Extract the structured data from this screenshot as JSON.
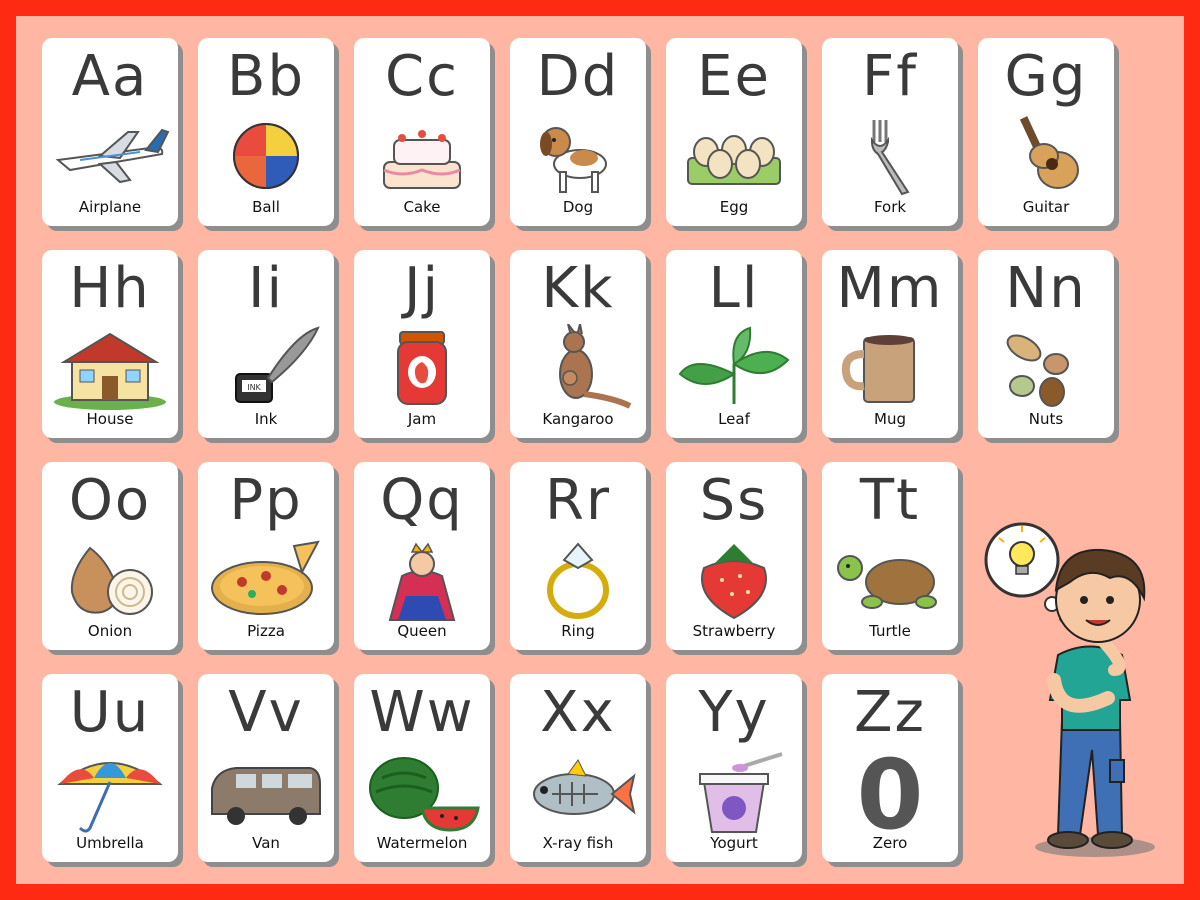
{
  "cards": [
    {
      "upper": "A",
      "lower": "a",
      "word": "Airplane",
      "icon": "airplane-icon"
    },
    {
      "upper": "B",
      "lower": "b",
      "word": "Ball",
      "icon": "ball-icon"
    },
    {
      "upper": "C",
      "lower": "c",
      "word": "Cake",
      "icon": "cake-icon"
    },
    {
      "upper": "D",
      "lower": "d",
      "word": "Dog",
      "icon": "dog-icon"
    },
    {
      "upper": "E",
      "lower": "e",
      "word": "Egg",
      "icon": "egg-icon"
    },
    {
      "upper": "F",
      "lower": "f",
      "word": "Fork",
      "icon": "fork-icon"
    },
    {
      "upper": "G",
      "lower": "g",
      "word": "Guitar",
      "icon": "guitar-icon"
    },
    {
      "upper": "H",
      "lower": "h",
      "word": "House",
      "icon": "house-icon"
    },
    {
      "upper": "I",
      "lower": "i",
      "word": "Ink",
      "icon": "ink-icon",
      "extra": "INK"
    },
    {
      "upper": "J",
      "lower": "j",
      "word": "Jam",
      "icon": "jam-icon"
    },
    {
      "upper": "K",
      "lower": "k",
      "word": "Kangaroo",
      "icon": "kangaroo-icon"
    },
    {
      "upper": "L",
      "lower": "l",
      "word": "Leaf",
      "icon": "leaf-icon"
    },
    {
      "upper": "M",
      "lower": "m",
      "word": "Mug",
      "icon": "mug-icon"
    },
    {
      "upper": "N",
      "lower": "n",
      "word": "Nuts",
      "icon": "nuts-icon"
    },
    {
      "upper": "O",
      "lower": "o",
      "word": "Onion",
      "icon": "onion-icon"
    },
    {
      "upper": "P",
      "lower": "p",
      "word": "Pizza",
      "icon": "pizza-icon"
    },
    {
      "upper": "Q",
      "lower": "q",
      "word": "Queen",
      "icon": "queen-icon"
    },
    {
      "upper": "R",
      "lower": "r",
      "word": "Ring",
      "icon": "ring-icon"
    },
    {
      "upper": "S",
      "lower": "s",
      "word": "Strawberry",
      "icon": "strawberry-icon"
    },
    {
      "upper": "T",
      "lower": "t",
      "word": "Turtle",
      "icon": "turtle-icon"
    },
    {
      "upper": "U",
      "lower": "u",
      "word": "Umbrella",
      "icon": "umbrella-icon"
    },
    {
      "upper": "V",
      "lower": "v",
      "word": "Van",
      "icon": "van-icon"
    },
    {
      "upper": "W",
      "lower": "w",
      "word": "Watermelon",
      "icon": "watermelon-icon"
    },
    {
      "upper": "X",
      "lower": "x",
      "word": "X-ray  fish",
      "icon": "xray-fish-icon"
    },
    {
      "upper": "Y",
      "lower": "y",
      "word": "Yogurt",
      "icon": "yogurt-icon"
    },
    {
      "upper": "Z",
      "lower": "z",
      "word": "Zero",
      "icon": "zero-icon",
      "extra": "0"
    }
  ],
  "colors": {
    "border": "#ff2a12",
    "background": "#ffb6a3",
    "card": "#ffffff",
    "shadow": "#8e8e8e",
    "letters": "#3a3a3a"
  },
  "decoration": {
    "character": "thinking-boy",
    "thought": "lightbulb-icon"
  }
}
